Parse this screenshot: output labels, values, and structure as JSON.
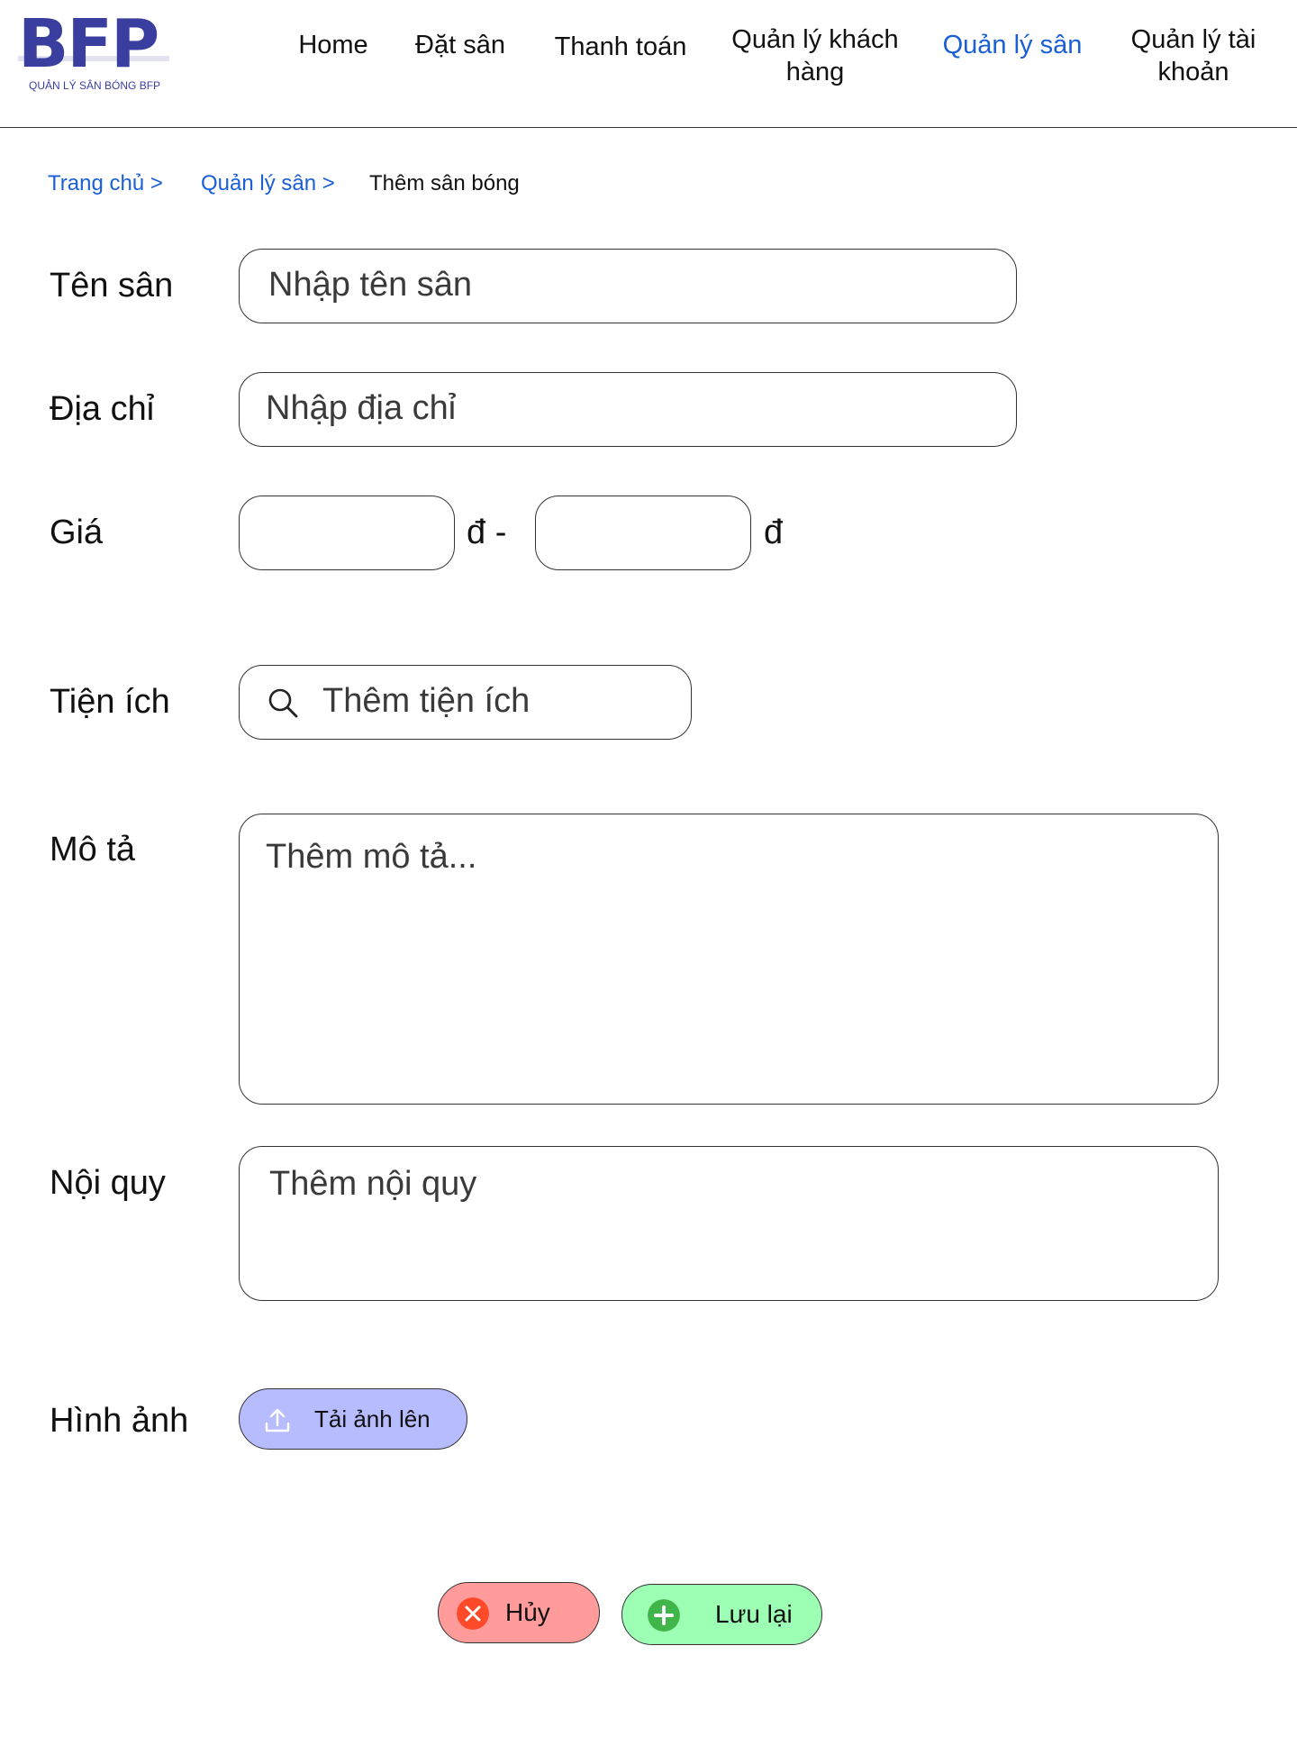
{
  "brand": {
    "logo_text": "BFP",
    "logo_subtitle": "QUẢN LÝ SÂN BÓNG BFP",
    "primary_color": "#3a3f9f"
  },
  "nav": {
    "home": "Home",
    "booking": "Đặt sân",
    "payment": "Thanh toán",
    "customers_line1": "Quản lý khách",
    "customers_line2": "hàng",
    "fields": "Quản lý sân",
    "accounts_line1": "Quản lý tài",
    "accounts_line2": "khoản",
    "active_color": "#1a5fd6"
  },
  "breadcrumb": {
    "home": "Trang chủ >",
    "fields": "Quản lý sân >",
    "current": "Thêm sân bóng"
  },
  "form": {
    "name": {
      "label": "Tên sân",
      "placeholder": "Nhập tên sân"
    },
    "address": {
      "label": "Địa chỉ",
      "placeholder": "Nhập địa chỉ"
    },
    "price": {
      "label": "Giá",
      "min_value": "",
      "max_value": "",
      "currency_separator": "đ -",
      "currency": "đ"
    },
    "amenities": {
      "label": "Tiện ích",
      "placeholder": "Thêm tiện ích",
      "icon": "search-icon"
    },
    "description": {
      "label": "Mô tả",
      "placeholder": "Thêm mô tả..."
    },
    "rules": {
      "label": "Nội quy",
      "placeholder": "Thêm nội quy"
    },
    "images": {
      "label": "Hình ảnh",
      "upload_label": "Tải ảnh lên",
      "upload_color": "#b7bcff",
      "icon": "upload-icon"
    }
  },
  "actions": {
    "cancel_label": "Hủy",
    "cancel_color": "#ff9b9b",
    "cancel_icon": "close-circle-icon",
    "save_label": "Lưu lại",
    "save_color": "#9dffb3",
    "save_icon": "plus-circle-icon"
  }
}
